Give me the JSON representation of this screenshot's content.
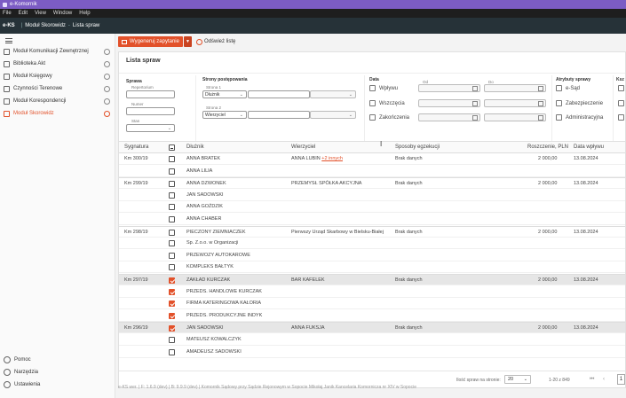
{
  "window": {
    "title": "e-Komornik"
  },
  "menu": [
    "File",
    "Edit",
    "View",
    "Window",
    "Help"
  ],
  "navbar": {
    "brand": "e-KS",
    "crumb1": "Moduł Skorowidz",
    "crumb2": "Lista spraw"
  },
  "sidebar": {
    "items": [
      {
        "label": "Moduł Komunikacji Zewnętrznej",
        "icon": "module-icon"
      },
      {
        "label": "Biblioteka Akt",
        "icon": "library-icon"
      },
      {
        "label": "Moduł Księgowy",
        "icon": "accounting-icon"
      },
      {
        "label": "Czynności Terenowe",
        "icon": "field-icon"
      },
      {
        "label": "Moduł Korespondencji",
        "icon": "mail-icon"
      },
      {
        "label": "Moduł Skorowidz",
        "icon": "index-icon",
        "active": true
      }
    ],
    "bottom": [
      {
        "label": "Pomoc",
        "icon": "help-icon"
      },
      {
        "label": "Narzędzia",
        "icon": "tools-icon"
      },
      {
        "label": "Ustawienia",
        "icon": "settings-icon"
      }
    ]
  },
  "toolbar": {
    "generate_label": "Wygeneruj zapytanie",
    "refresh_label": "Odśwież listę"
  },
  "card": {
    "title": "Lista spraw"
  },
  "filters": {
    "sprawa": {
      "title": "Sprawa",
      "repertorium_label": "Repertorium",
      "numer_label": "Numer",
      "stan_label": "Stan",
      "stan_value": ""
    },
    "strony": {
      "title": "Strony postępowania",
      "strona1_label": "Strona 1",
      "strona1_role": "Dłużnik",
      "strona2_label": "Strona 2",
      "strona2_role": "Wierzyciel"
    },
    "data": {
      "title": "Data",
      "od_label": "Od",
      "do_label": "Do",
      "options": [
        "Wpływu",
        "Wszczęcia",
        "Zakończenia"
      ]
    },
    "atrybuty": {
      "title": "Atrybuty sprawy",
      "options": [
        "e-Sąd",
        "Zabezpieczenie",
        "Administracyjna"
      ]
    },
    "extra": {
      "title": "Ksz"
    }
  },
  "table": {
    "headers": {
      "sygnatura": "Sygnatura",
      "dluznik": "Dłużnik",
      "wierzyciel": "Wierzyciel",
      "sposoby": "Sposoby egzekucji",
      "roszczenie": "Roszczenie, PLN",
      "data": "Data wpływu"
    },
    "rows": [
      {
        "sygnatura": "Km 300/19",
        "dluznik": "ANNA BRATEK",
        "wierzyciel": "ANNA LUBIN",
        "wierzyciel_link": "+2 innych",
        "sposoby": "Brak danych",
        "roszczenie": "2 000,00",
        "data": "13.08.2024",
        "checked": false,
        "group_start": true,
        "selected": false
      },
      {
        "sygnatura": "",
        "dluznik": "ANNA LILIA",
        "wierzyciel": "",
        "wierzyciel_link": "",
        "sposoby": "",
        "roszczenie": "",
        "data": "",
        "checked": false,
        "group_start": false,
        "selected": false
      },
      {
        "sygnatura": "Km 299/19",
        "dluznik": "ANNA DZWONEK",
        "wierzyciel": "PRZEMYSŁ SPÓŁKA AKCYJNA",
        "wierzyciel_link": "",
        "sposoby": "Brak danych",
        "roszczenie": "2 000,00",
        "data": "13.08.2024",
        "checked": false,
        "group_start": true,
        "selected": false
      },
      {
        "sygnatura": "",
        "dluznik": "JAN SADOWSKI",
        "wierzyciel": "",
        "wierzyciel_link": "",
        "sposoby": "",
        "roszczenie": "",
        "data": "",
        "checked": false,
        "group_start": false,
        "selected": false
      },
      {
        "sygnatura": "",
        "dluznik": "ANNA GOŹDZIK",
        "wierzyciel": "",
        "wierzyciel_link": "",
        "sposoby": "",
        "roszczenie": "",
        "data": "",
        "checked": false,
        "group_start": false,
        "selected": false
      },
      {
        "sygnatura": "",
        "dluznik": "ANNA CHABER",
        "wierzyciel": "",
        "wierzyciel_link": "",
        "sposoby": "",
        "roszczenie": "",
        "data": "",
        "checked": false,
        "group_start": false,
        "selected": false
      },
      {
        "sygnatura": "Km 298/19",
        "dluznik": "PIECZONY ZIEMNIACZEK",
        "wierzyciel": "Pierwszy Urząd Skarbowy w Bielsku-Białej",
        "wierzyciel_link": "",
        "sposoby": "Brak danych",
        "roszczenie": "2 000,00",
        "data": "13.08.2024",
        "checked": false,
        "group_start": true,
        "selected": false
      },
      {
        "sygnatura": "",
        "dluznik": "Sp. Z.o.o. w Organizacji",
        "wierzyciel": "",
        "wierzyciel_link": "",
        "sposoby": "",
        "roszczenie": "",
        "data": "",
        "checked": false,
        "group_start": false,
        "selected": false
      },
      {
        "sygnatura": "",
        "dluznik": "PRZEWOZY AUTOKAROWE",
        "wierzyciel": "",
        "wierzyciel_link": "",
        "sposoby": "",
        "roszczenie": "",
        "data": "",
        "checked": false,
        "group_start": false,
        "selected": false
      },
      {
        "sygnatura": "",
        "dluznik": "KOMPLEKS BAŁTYK",
        "wierzyciel": "",
        "wierzyciel_link": "",
        "sposoby": "",
        "roszczenie": "",
        "data": "",
        "checked": false,
        "group_start": false,
        "selected": false
      },
      {
        "sygnatura": "Km 297/19",
        "dluznik": "ZAKŁAD KURCZAK",
        "wierzyciel": "BAR KAFELEK",
        "wierzyciel_link": "",
        "sposoby": "Brak danych",
        "roszczenie": "2 000,00",
        "data": "13.08.2024",
        "checked": true,
        "group_start": true,
        "selected": true
      },
      {
        "sygnatura": "",
        "dluznik": "PRZEDS. HANDLOWE KURCZAK",
        "wierzyciel": "",
        "wierzyciel_link": "",
        "sposoby": "",
        "roszczenie": "",
        "data": "",
        "checked": true,
        "group_start": false,
        "selected": false
      },
      {
        "sygnatura": "",
        "dluznik": "FIRMA KATERINGOWA KAŁORIA",
        "wierzyciel": "",
        "wierzyciel_link": "",
        "sposoby": "",
        "roszczenie": "",
        "data": "",
        "checked": true,
        "group_start": false,
        "selected": false
      },
      {
        "sygnatura": "",
        "dluznik": "PRZEDS. PRODUKCYJNE INDYK",
        "wierzyciel": "",
        "wierzyciel_link": "",
        "sposoby": "",
        "roszczenie": "",
        "data": "",
        "checked": true,
        "group_start": false,
        "selected": false
      },
      {
        "sygnatura": "Km 296/19",
        "dluznik": "JAN SADOWSKI",
        "wierzyciel": "ANNA FUKSJA",
        "wierzyciel_link": "",
        "sposoby": "Brak danych",
        "roszczenie": "2 000,00",
        "data": "13.08.2024",
        "checked": true,
        "group_start": true,
        "selected": true
      },
      {
        "sygnatura": "",
        "dluznik": "MATEUSZ KOWALCZYK",
        "wierzyciel": "",
        "wierzyciel_link": "",
        "sposoby": "",
        "roszczenie": "",
        "data": "",
        "checked": false,
        "group_start": false,
        "selected": false
      },
      {
        "sygnatura": "",
        "dluznik": "AMADEUSZ SADOWSKI",
        "wierzyciel": "",
        "wierzyciel_link": "",
        "sposoby": "",
        "roszczenie": "",
        "data": "",
        "checked": false,
        "group_start": false,
        "selected": false
      }
    ]
  },
  "pagination": {
    "per_page_label": "Ilość spraw na stronie:",
    "per_page": "20",
    "range": "1-20 z 849",
    "current_page": "1"
  },
  "status_bar": "e-KS wer. | F: 1.6.9 (dev) | B: 9.9.9 (dev) | Komornik Sądowy przy Sądzie Rejonowym w Sopocie Mikołaj Janik Kancelaria Komornicza nr XIV w Sopocie",
  "colors": {
    "accent": "#e2512a",
    "titlebar": "#7c5cc4",
    "navbar": "#263238"
  }
}
